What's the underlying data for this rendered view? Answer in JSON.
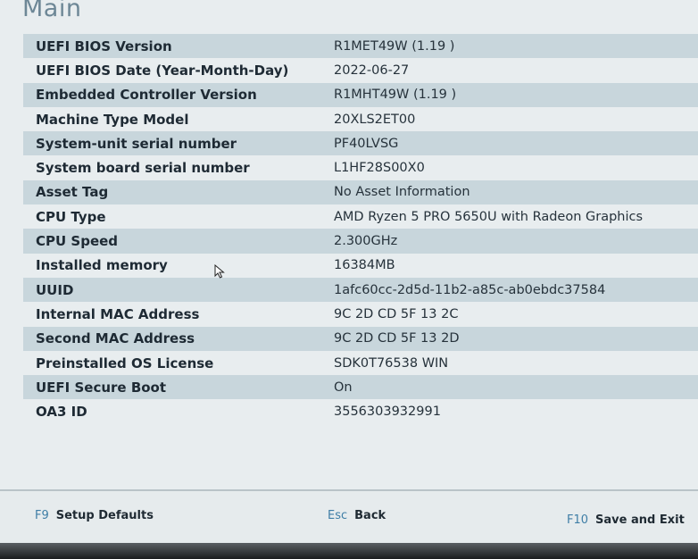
{
  "page": {
    "title": "Main"
  },
  "rows": [
    {
      "label": "UEFI BIOS Version",
      "value": "R1MET49W (1.19 )"
    },
    {
      "label": "UEFI BIOS Date (Year-Month-Day)",
      "value": "2022-06-27"
    },
    {
      "label": "Embedded Controller Version",
      "value": "R1MHT49W (1.19 )"
    },
    {
      "label": "Machine Type Model",
      "value": "20XLS2ET00"
    },
    {
      "label": "System-unit serial number",
      "value": "PF40LVSG"
    },
    {
      "label": "System board serial number",
      "value": "L1HF28S00X0"
    },
    {
      "label": "Asset Tag",
      "value": "No Asset Information"
    },
    {
      "label": "CPU Type",
      "value": "AMD Ryzen 5 PRO 5650U with Radeon Graphics"
    },
    {
      "label": "CPU Speed",
      "value": "2.300GHz"
    },
    {
      "label": "Installed memory",
      "value": "16384MB"
    },
    {
      "label": "UUID",
      "value": "1afc60cc-2d5d-11b2-a85c-ab0ebdc37584"
    },
    {
      "label": "Internal MAC Address",
      "value": "9C 2D CD 5F 13 2C"
    },
    {
      "label": "Second MAC Address",
      "value": "9C 2D CD 5F 13 2D"
    },
    {
      "label": "Preinstalled OS License",
      "value": "SDK0T76538 WIN"
    },
    {
      "label": "UEFI Secure Boot",
      "value": "On"
    },
    {
      "label": "OA3 ID",
      "value": "3556303932991"
    }
  ],
  "footer": {
    "f9": {
      "key": "F9",
      "label": "Setup Defaults"
    },
    "esc": {
      "key": "Esc",
      "label": "Back"
    },
    "f10": {
      "key": "F10",
      "label": "Save and Exit"
    }
  },
  "icons": {
    "pointer": "mouse-pointer-icon"
  },
  "colors": {
    "row_highlight": "#c8d6dc",
    "title": "#6d8796",
    "key": "#3f7ea6"
  }
}
